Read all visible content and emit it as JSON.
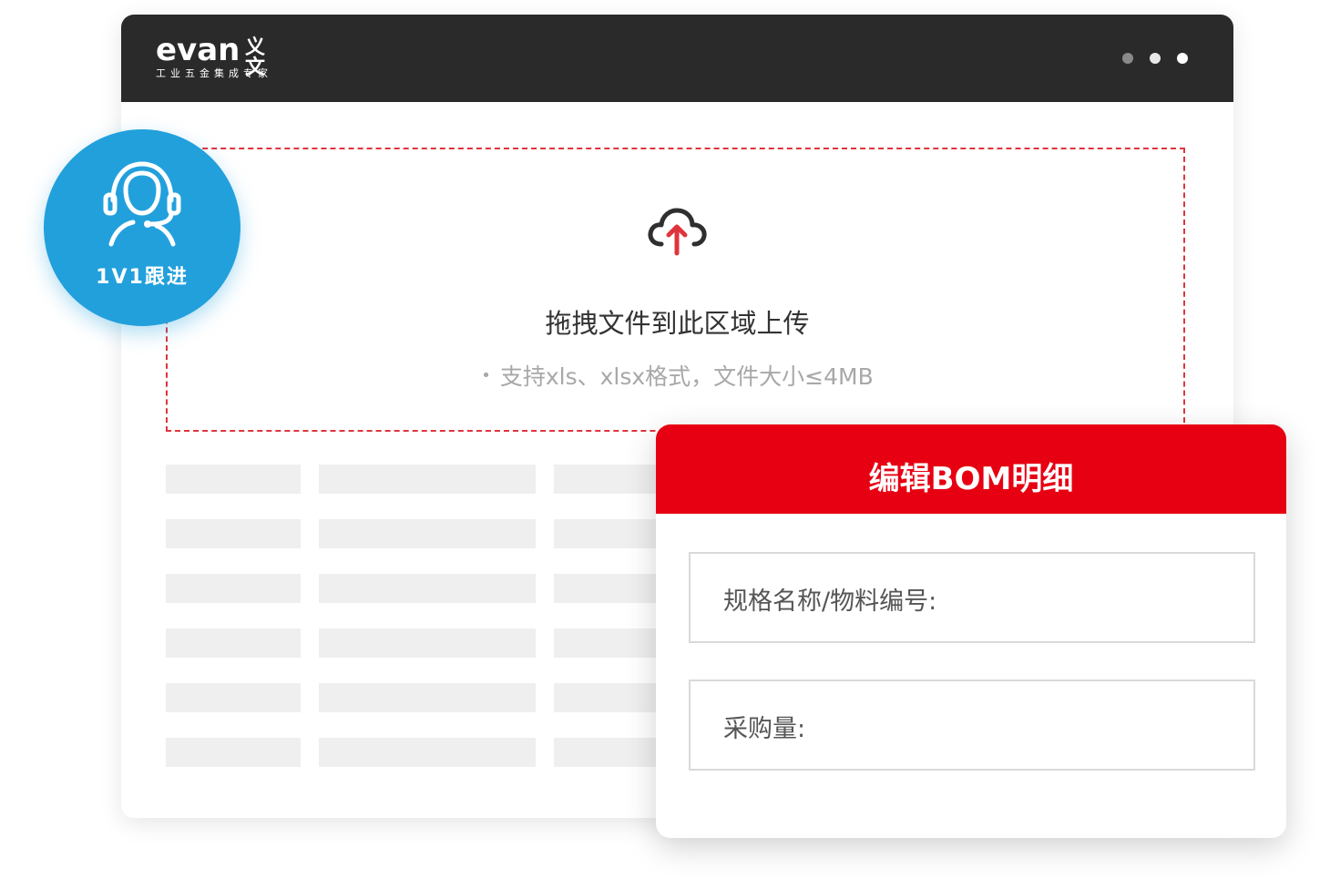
{
  "colors": {
    "titlebar": "#2a2a2a",
    "accent_red": "#e60012",
    "dashed_border": "#e0343c",
    "badge_blue": "#22a0dc",
    "skeleton": "#efefef",
    "dot_dim": "#8a8a8a",
    "dot_bright": "#ffffff"
  },
  "header": {
    "logo_word": "evan",
    "logo_cn": "义文",
    "logo_tagline": "工业五金集成专家",
    "window_dots": [
      "dot",
      "dot",
      "dot"
    ]
  },
  "upload": {
    "icon": "cloud-upload-icon",
    "title": "拖拽文件到此区域上传",
    "bullet": "•",
    "hint": "支持xls、xlsx格式，文件大小≤4MB"
  },
  "badge": {
    "icon": "customer-service-headset-icon",
    "label": "1V1跟进"
  },
  "bom_modal": {
    "title": "编辑BOM明细",
    "fields": [
      {
        "label": "规格名称/物料编号:"
      },
      {
        "label": "采购量:"
      }
    ]
  }
}
